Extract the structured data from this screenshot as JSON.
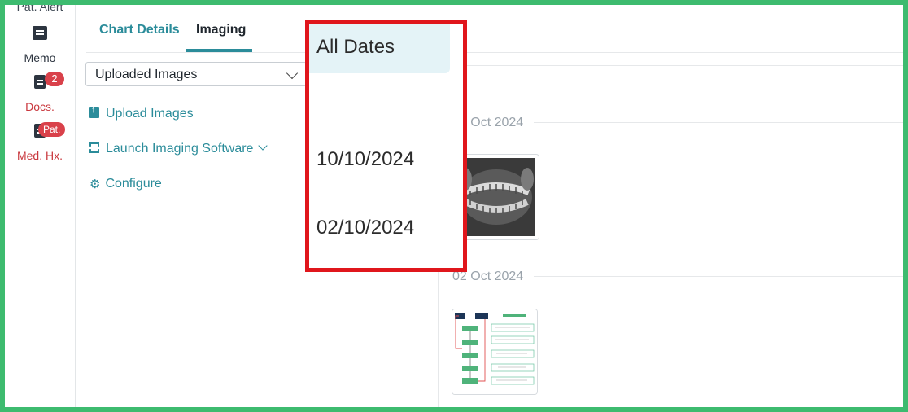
{
  "rail": {
    "items": [
      {
        "label": "Pat. Alert"
      },
      {
        "label": "Memo"
      },
      {
        "label": "Docs.",
        "badge": "2"
      },
      {
        "label": "Med. Hx.",
        "badge": "Pat."
      }
    ]
  },
  "tabs": [
    {
      "label": "Chart Details"
    },
    {
      "label": "Imaging",
      "active": true
    }
  ],
  "image_filter": {
    "selected": "Uploaded Images"
  },
  "actions": {
    "upload": "Upload Images",
    "launch": "Launch Imaging Software",
    "configure": "Configure"
  },
  "date_dropdown": {
    "options": [
      "All Dates",
      "10/10/2024",
      "02/10/2024"
    ],
    "selected": "All Dates"
  },
  "gallery": {
    "groups": [
      {
        "date": "10 Oct 2024",
        "thumbnail": "dental-xray-image"
      },
      {
        "date": "02 Oct 2024",
        "thumbnail": "flowchart-document-image"
      }
    ]
  },
  "colors": {
    "accent": "#2b8c9a",
    "alert": "#d9414a",
    "highlight_border": "#e0161c",
    "outer_border": "#3dbb6f"
  }
}
